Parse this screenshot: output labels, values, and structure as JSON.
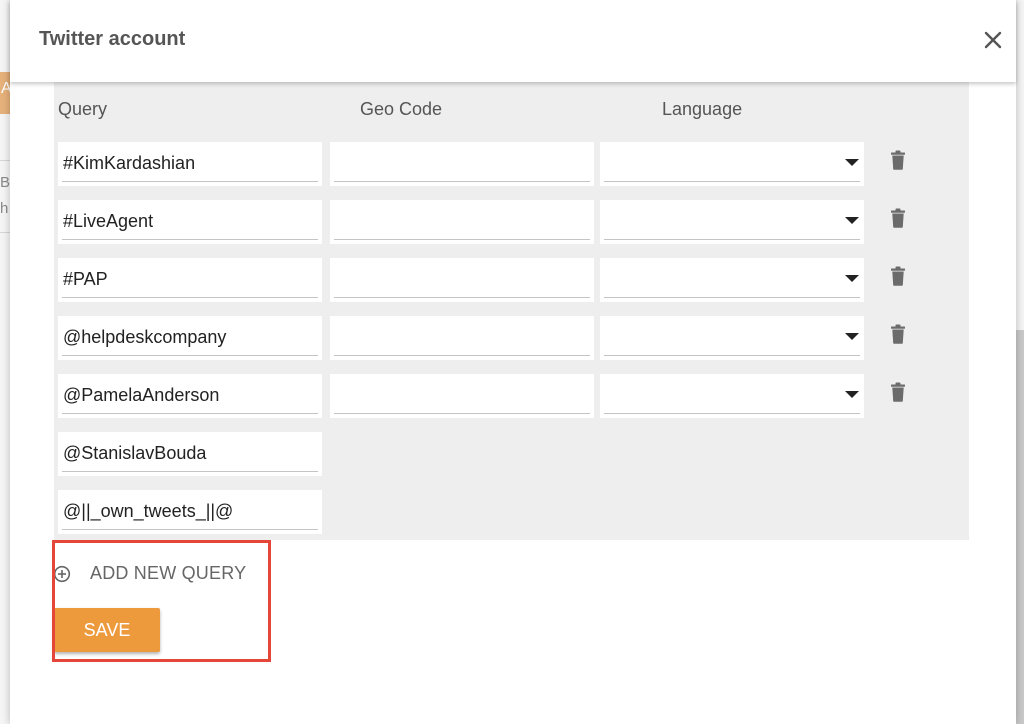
{
  "dialog": {
    "title": "Twitter account"
  },
  "background": {
    "chip_letter": "A",
    "text_lines": [
      "Bo",
      "h"
    ]
  },
  "columns": {
    "query": "Query",
    "geo_code": "Geo Code",
    "language": "Language"
  },
  "rows": [
    {
      "query": "#KimKardashian",
      "geo_code": "",
      "language": "",
      "has_options": true
    },
    {
      "query": "#LiveAgent",
      "geo_code": "",
      "language": "",
      "has_options": true
    },
    {
      "query": "#PAP",
      "geo_code": "",
      "language": "",
      "has_options": true
    },
    {
      "query": "@helpdeskcompany",
      "geo_code": "",
      "language": "",
      "has_options": true
    },
    {
      "query": "@PamelaAnderson",
      "geo_code": "",
      "language": "",
      "has_options": true
    },
    {
      "query": "@StanislavBouda",
      "has_options": false
    },
    {
      "query": "@||_own_tweets_||@",
      "has_options": false
    }
  ],
  "actions": {
    "add_query_label": "ADD NEW QUERY",
    "save_label": "SAVE"
  },
  "icons": {
    "close": "close-icon",
    "delete": "trash-icon",
    "add": "plus-circle-icon",
    "dropdown": "caret-down-icon"
  },
  "colors": {
    "accent": "#ed9a3d",
    "highlight": "#e4463a",
    "panel": "#eeeeee"
  }
}
